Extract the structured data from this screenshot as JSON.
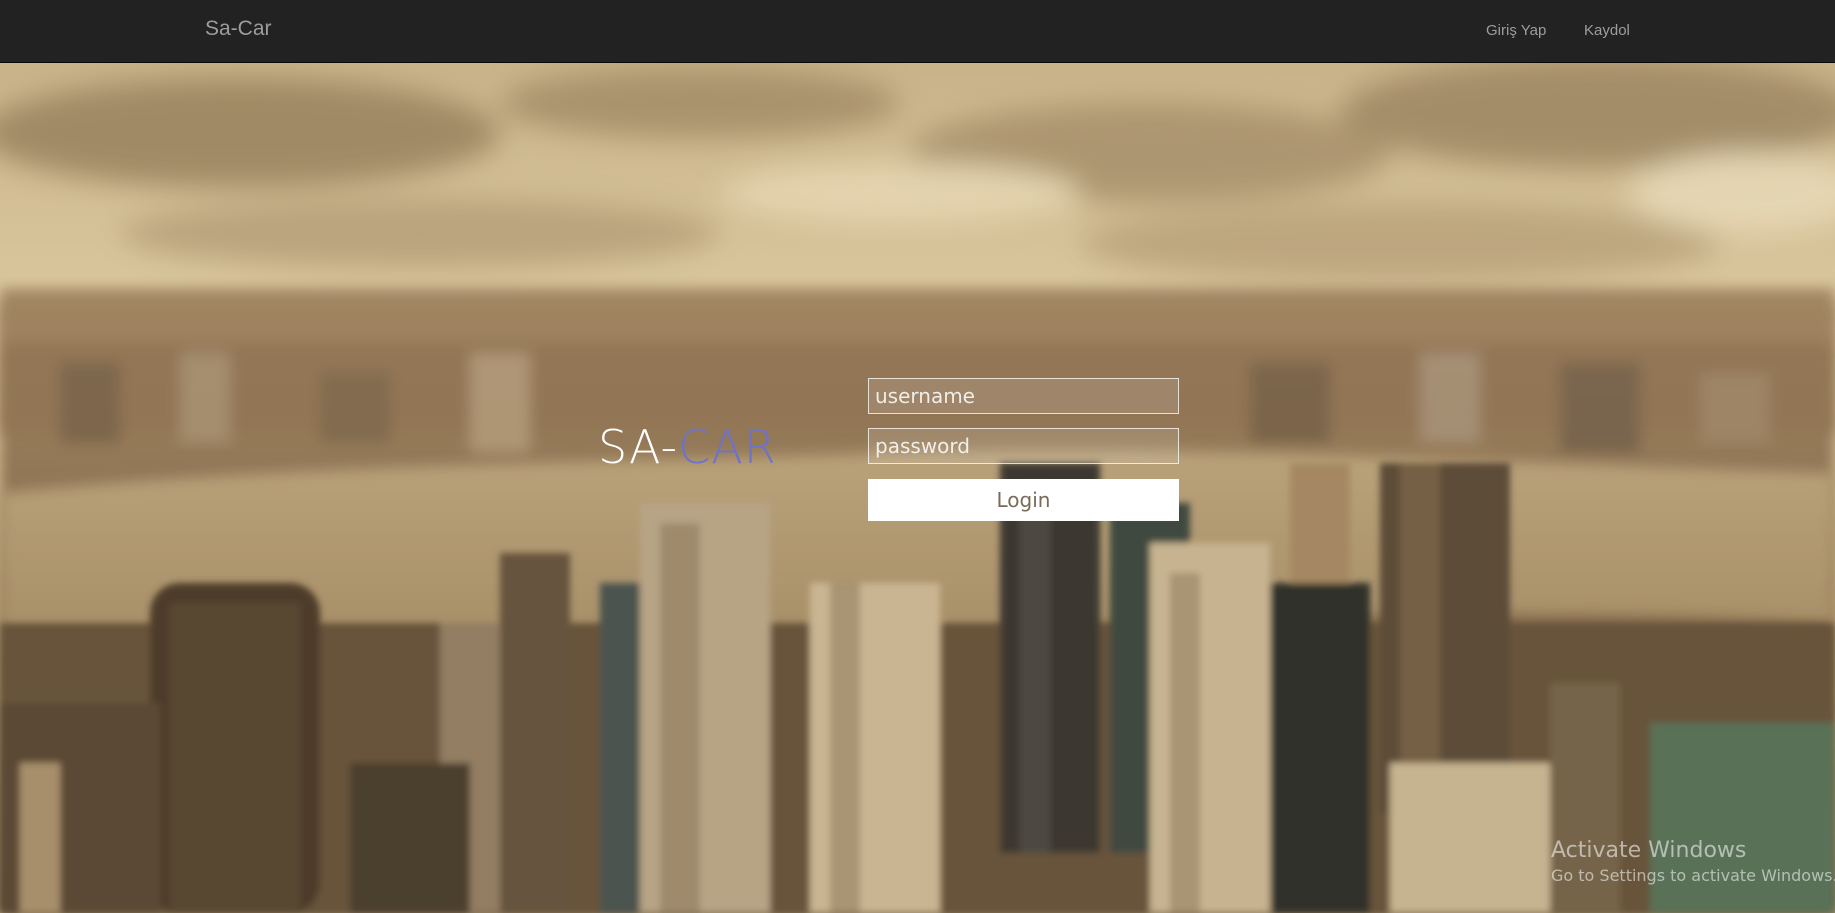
{
  "navbar": {
    "brand": "Sa-Car",
    "links": [
      {
        "label": "Giriş Yap"
      },
      {
        "label": "Kaydol"
      }
    ]
  },
  "hero": {
    "logo_prefix": "SA-",
    "logo_accent": "CAR",
    "accent_color": "#6f72c9"
  },
  "login_form": {
    "username_placeholder": "username",
    "username_value": "",
    "password_placeholder": "password",
    "password_value": "",
    "submit_label": "Login"
  },
  "watermark": {
    "title": "Activate Windows",
    "subtitle": "Go to Settings to activate Windows."
  },
  "colors": {
    "navbar_bg": "#222222",
    "nav_text": "#9d9d9d",
    "button_text": "#7a6b58"
  }
}
